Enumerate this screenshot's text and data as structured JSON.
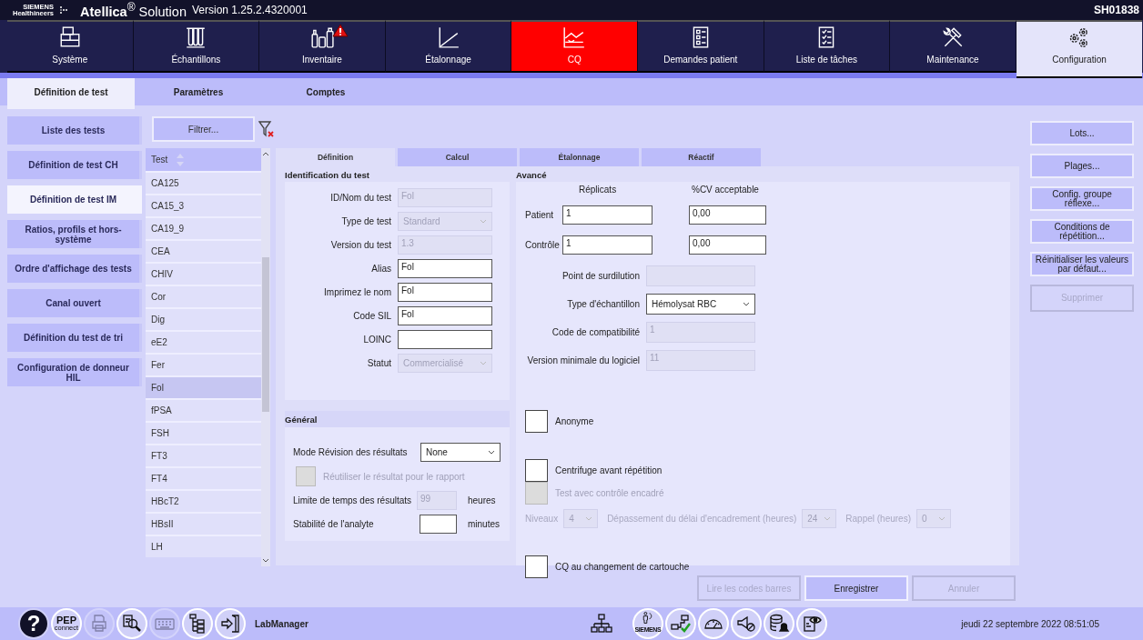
{
  "title_bar": {
    "brand": "SIEMENS",
    "brand_sub": "Healthineers",
    "product": "**Atellica**$^{®}$ Solution",
    "version": "Version 1.25.2.4320001",
    "system_id": "SH01838"
  },
  "nav": [
    {
      "kind": "system",
      "label": "Système",
      "selected": false,
      "alert": false,
      "warning": false
    },
    {
      "kind": "samples",
      "label": "Échantillons",
      "selected": false,
      "alert": false,
      "warning": false
    },
    {
      "kind": "inventory",
      "label": "Inventaire",
      "selected": false,
      "alert": false,
      "warning": true
    },
    {
      "kind": "calibration",
      "label": "Étalonnage",
      "selected": false,
      "alert": false,
      "warning": false
    },
    {
      "kind": "qc",
      "label": "CQ",
      "selected": false,
      "alert": true,
      "warning": false
    },
    {
      "kind": "orders",
      "label": "Demandes patient",
      "selected": false,
      "alert": false,
      "warning": false
    },
    {
      "kind": "worklist",
      "label": "Liste de tâches",
      "selected": false,
      "alert": false,
      "warning": false
    },
    {
      "kind": "maintenance",
      "label": "Maintenance",
      "selected": false,
      "alert": false,
      "warning": false
    },
    {
      "kind": "config",
      "label": "Configuration",
      "selected": true,
      "alert": false,
      "warning": false
    }
  ],
  "subtabs": [
    {
      "label": "Définition de test",
      "selected": true
    },
    {
      "label": "Paramètres",
      "selected": false
    },
    {
      "label": "Comptes",
      "selected": false
    }
  ],
  "sidebar": [
    {
      "label": "Liste des tests",
      "selected": false
    },
    {
      "label": "Définition de test CH",
      "selected": false
    },
    {
      "label": "Définition de test IM",
      "selected": true
    },
    {
      "label": "Ratios, profils et hors-système",
      "selected": false
    },
    {
      "label": "Ordre d'affichage des tests",
      "selected": false
    },
    {
      "label": "Canal ouvert",
      "selected": false
    },
    {
      "label": "Définition du test de tri",
      "selected": false
    },
    {
      "label": "Configuration de donneur HIL",
      "selected": false
    }
  ],
  "filter": {
    "label": "Filtrer..."
  },
  "test_list": {
    "header": "Test",
    "rows": [
      {
        "label": "CA125",
        "selected": false
      },
      {
        "label": "CA15_3",
        "selected": false
      },
      {
        "label": "CA19_9",
        "selected": false
      },
      {
        "label": "CEA",
        "selected": false
      },
      {
        "label": "CHIV",
        "selected": false
      },
      {
        "label": "Cor",
        "selected": false
      },
      {
        "label": "Dig",
        "selected": false
      },
      {
        "label": "eE2",
        "selected": false
      },
      {
        "label": "Fer",
        "selected": false
      },
      {
        "label": "Fol",
        "selected": true
      },
      {
        "label": "fPSA",
        "selected": false
      },
      {
        "label": "FSH",
        "selected": false
      },
      {
        "label": "FT3",
        "selected": false
      },
      {
        "label": "FT4",
        "selected": false
      },
      {
        "label": "HBcT2",
        "selected": false
      },
      {
        "label": "HBsII",
        "selected": false
      },
      {
        "label": "LH",
        "selected": false
      }
    ]
  },
  "detail_tabs": [
    {
      "label": "Définition",
      "selected": true
    },
    {
      "label": "Calcul",
      "selected": false
    },
    {
      "label": "Étalonnage",
      "selected": false
    },
    {
      "label": "Réactif",
      "selected": false
    }
  ],
  "identification": {
    "title": "Identification du test",
    "fields": [
      {
        "label": "ID/Nom du test",
        "value": "Fol",
        "kind": "text",
        "disabled": true
      },
      {
        "label": "Type de test",
        "value": "Standard",
        "kind": "select",
        "disabled": true
      },
      {
        "label": "Version du test",
        "value": "1.3",
        "kind": "text",
        "disabled": true
      },
      {
        "label": "Alias",
        "value": "Fol",
        "kind": "text",
        "disabled": false
      },
      {
        "label": "Imprimez le nom",
        "value": "Fol",
        "kind": "text",
        "disabled": false
      },
      {
        "label": "Code SIL",
        "value": "Fol",
        "kind": "text",
        "disabled": false
      },
      {
        "label": "LOINC",
        "kind": "text",
        "disabled": false
      },
      {
        "label": "Statut",
        "value": "Commercialisé",
        "kind": "select",
        "disabled": true
      }
    ]
  },
  "general": {
    "title": "Général",
    "review_mode": {
      "label": "Mode Révision des résultats",
      "value": "None"
    },
    "reuse": {
      "label": "Réutiliser le résultat pour le rapport",
      "checked": false,
      "disabled": true
    },
    "time_limit": {
      "label": "Limite de temps des résultats",
      "value": "99",
      "unit": "heures",
      "disabled": true
    },
    "stability": {
      "label": "Stabilité de l'analyte",
      "unit": "minutes",
      "disabled": false
    }
  },
  "advanced": {
    "title": "Avancé",
    "columns": [
      "Réplicats",
      "%CV acceptable"
    ],
    "rows": [
      {
        "label": "Patient",
        "replicates": "1",
        "cv": "0,00"
      },
      {
        "label": "Contrôle",
        "replicates": "1",
        "cv": "0,00"
      }
    ],
    "fields": [
      {
        "label": "Point de surdilution",
        "kind": "text",
        "disabled": true
      },
      {
        "label": "Type d'échantillon",
        "value": "Hémolysat RBC",
        "kind": "select",
        "disabled": false
      },
      {
        "label": "Code de compatibilité",
        "value": "1",
        "kind": "text",
        "disabled": true
      },
      {
        "label": "Version minimale du logiciel",
        "value": "11",
        "kind": "text",
        "disabled": true
      }
    ],
    "anonymous": {
      "label": "Anonyme",
      "checked": false,
      "disabled": false
    },
    "centrifuge": {
      "label": "Centrifuge avant répétition",
      "checked": false,
      "disabled": false
    },
    "bracketed": {
      "label": "Test avec contrôle encadré",
      "checked": false,
      "disabled": true
    },
    "bracket": {
      "disabled": true,
      "levels_label": "Niveaux",
      "levels": "4",
      "overrun_label": "Dépassement du délai d'encadrement (heures)",
      "overrun": "24",
      "reminder_label": "Rappel (heures)",
      "reminder": "0"
    },
    "qc_cartridge": {
      "label": "CQ au changement de cartouche",
      "checked": false,
      "disabled": false
    }
  },
  "side_buttons": [
    {
      "label": "Lots...",
      "disabled": false
    },
    {
      "label": "Plages...",
      "disabled": false
    },
    {
      "label": "Config. groupe réflexe...",
      "disabled": false
    },
    {
      "label": "Conditions de répétition...",
      "disabled": false
    },
    {
      "label": "Réinitialiser les valeurs par défaut...",
      "disabled": false
    },
    {
      "label": "Supprimer",
      "disabled": true
    }
  ],
  "actions": [
    {
      "label": "Lire les codes barres",
      "disabled": true
    },
    {
      "label": "Enregistrer",
      "disabled": false
    },
    {
      "label": "Annuler",
      "disabled": true
    }
  ],
  "footer": {
    "tools": [
      {
        "kind": "help",
        "label": "?",
        "disabled": false
      },
      {
        "kind": "pep",
        "label": "PEP",
        "sublabel": "connect",
        "disabled": false
      },
      {
        "kind": "printer",
        "disabled": true
      },
      {
        "kind": "search",
        "disabled": false
      },
      {
        "kind": "keyboard",
        "disabled": true
      },
      {
        "kind": "tree",
        "disabled": false
      },
      {
        "kind": "exit",
        "disabled": false
      }
    ],
    "lab_manager": "LabManager",
    "status": [
      {
        "kind": "support",
        "label": "SIEMENS",
        "disabled": false
      },
      {
        "kind": "pc-check",
        "disabled": false
      },
      {
        "kind": "gauge",
        "disabled": false
      },
      {
        "kind": "mute",
        "disabled": false
      },
      {
        "kind": "db-bell",
        "disabled": false
      },
      {
        "kind": "eye-doc",
        "disabled": false
      }
    ],
    "datetime": "jeudi 22 septembre 2022 08:51:05"
  }
}
